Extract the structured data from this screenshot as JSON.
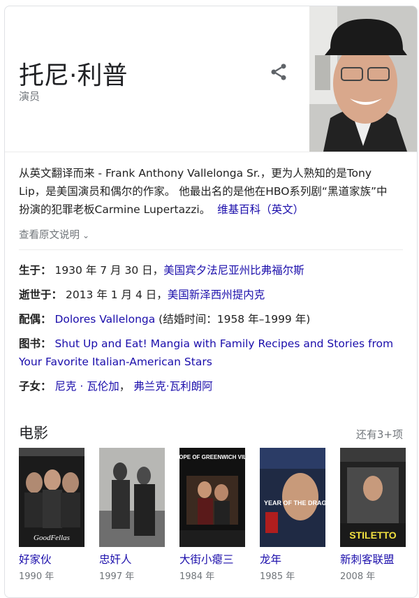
{
  "person": {
    "name": "托尼·利普",
    "role": "演员"
  },
  "description": {
    "text": "从英文翻译而来 - Frank Anthony Vallelonga Sr.，更为人熟知的是Tony Lip，是美国演员和偶尔的作家。 他最出名的是他在HBO系列剧“黑道家族”中扮演的犯罪老板Carmine Lupertazzi。",
    "source_link": "维基百科（英文）",
    "show_original": "查看原文说明"
  },
  "facts": {
    "born_label": "生于：",
    "born_date": "1930 年 7 月 30 日，",
    "born_place": "美国宾夕法尼亚州比弗福尔斯",
    "died_label": "逝世于：",
    "died_date": "2013 年 1 月 4 日，",
    "died_place": "美国新泽西州提内克",
    "spouse_label": "配偶：",
    "spouse_name": "Dolores Vallelonga",
    "spouse_detail": "(结婚时间：1958 年–1999 年)",
    "books_label": "图书：",
    "books_title": "Shut Up and Eat! Mangia with Family Recipes and Stories from Your Favorite Italian-American Stars",
    "children_label": "子女：",
    "child_1": "尼克 · 瓦伦加",
    "children_sep": "，",
    "child_2": "弗兰克·瓦利朗阿"
  },
  "movies": {
    "section_title": "电影",
    "more_label": "还有3+项",
    "items": [
      {
        "title": "好家伙",
        "year": "1990 年",
        "poster_text": "GoodFellas"
      },
      {
        "title": "忠奸人",
        "year": "1997 年",
        "poster_text": ""
      },
      {
        "title": "大街小瘪三",
        "year": "1984 年",
        "poster_text": "THE POPE OF GREENWICH VILLAGE"
      },
      {
        "title": "龙年",
        "year": "1985 年",
        "poster_text": "YEAR OF THE DRAGON"
      },
      {
        "title": "新刺客联盟",
        "year": "2008 年",
        "poster_text": "STILETTO"
      }
    ]
  }
}
